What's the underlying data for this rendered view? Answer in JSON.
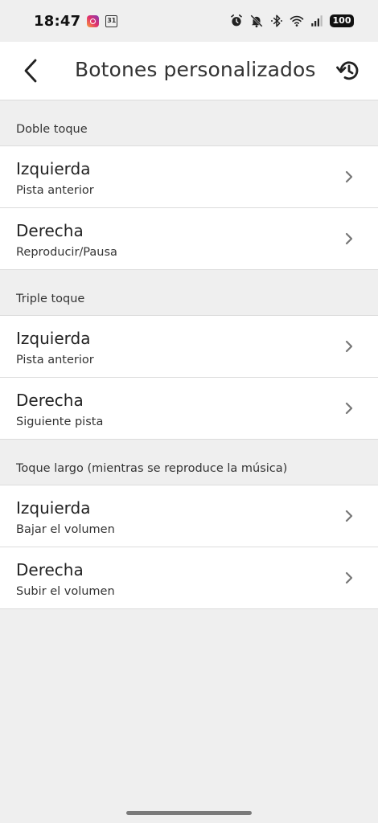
{
  "status_bar": {
    "time": "18:47",
    "left_icons": [
      "instagram-icon",
      "calendar-icon"
    ],
    "calendar_day": "31",
    "right_icons": [
      "alarm-icon",
      "bell-muted-icon",
      "bluetooth-icon",
      "wifi-icon",
      "signal-icon"
    ],
    "battery": "100"
  },
  "app_bar": {
    "title": "Botones personalizados",
    "back_icon": "back-arrow-icon",
    "reset_icon": "reset-icon"
  },
  "sections": [
    {
      "header": "Doble toque",
      "rows": [
        {
          "title": "Izquierda",
          "subtitle": "Pista anterior"
        },
        {
          "title": "Derecha",
          "subtitle": "Reproducir/Pausa"
        }
      ]
    },
    {
      "header": "Triple toque",
      "rows": [
        {
          "title": "Izquierda",
          "subtitle": "Pista anterior"
        },
        {
          "title": "Derecha",
          "subtitle": "Siguiente pista"
        }
      ]
    },
    {
      "header": "Toque largo (mientras se reproduce la música)",
      "rows": [
        {
          "title": "Izquierda",
          "subtitle": "Bajar el volumen"
        },
        {
          "title": "Derecha",
          "subtitle": "Subir el volumen"
        }
      ]
    }
  ],
  "colors": {
    "background": "#efefef",
    "surface": "#ffffff",
    "divider": "#dcdcdc",
    "chevron": "#777777"
  }
}
